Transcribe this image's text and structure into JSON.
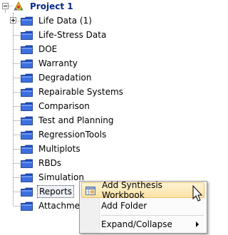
{
  "tree": {
    "root": {
      "label": "Project 1",
      "icon": "project-icon"
    },
    "items": [
      {
        "label": "Life Data (1)",
        "icon": "folder-icon",
        "expandable": true
      },
      {
        "label": "Life-Stress Data",
        "icon": "folder-icon"
      },
      {
        "label": "DOE",
        "icon": "folder-icon"
      },
      {
        "label": "Warranty",
        "icon": "folder-icon"
      },
      {
        "label": "Degradation",
        "icon": "folder-icon"
      },
      {
        "label": "Repairable Systems",
        "icon": "folder-icon"
      },
      {
        "label": "Comparison",
        "icon": "folder-icon"
      },
      {
        "label": "Test and Planning",
        "icon": "folder-icon"
      },
      {
        "label": "RegressionTools",
        "icon": "folder-icon"
      },
      {
        "label": "Multiplots",
        "icon": "folder-icon"
      },
      {
        "label": "RBDs",
        "icon": "folder-icon"
      },
      {
        "label": "Simulation",
        "icon": "folder-icon"
      },
      {
        "label": "Reports",
        "icon": "folder-icon",
        "selected": true
      },
      {
        "label": "Attachments",
        "icon": "folder-icon"
      }
    ]
  },
  "context_menu": {
    "items": [
      {
        "label": "Add Synthesis Workbook",
        "icon": "workbook-icon",
        "highlighted": true
      },
      {
        "label": "Add Folder"
      },
      {
        "label": "Expand/Collapse",
        "has_submenu": true
      }
    ]
  },
  "colors": {
    "folder_blue": "#2a57c9",
    "menu_highlight": "#fbe2a6",
    "project_label": "#0a2a8a"
  }
}
